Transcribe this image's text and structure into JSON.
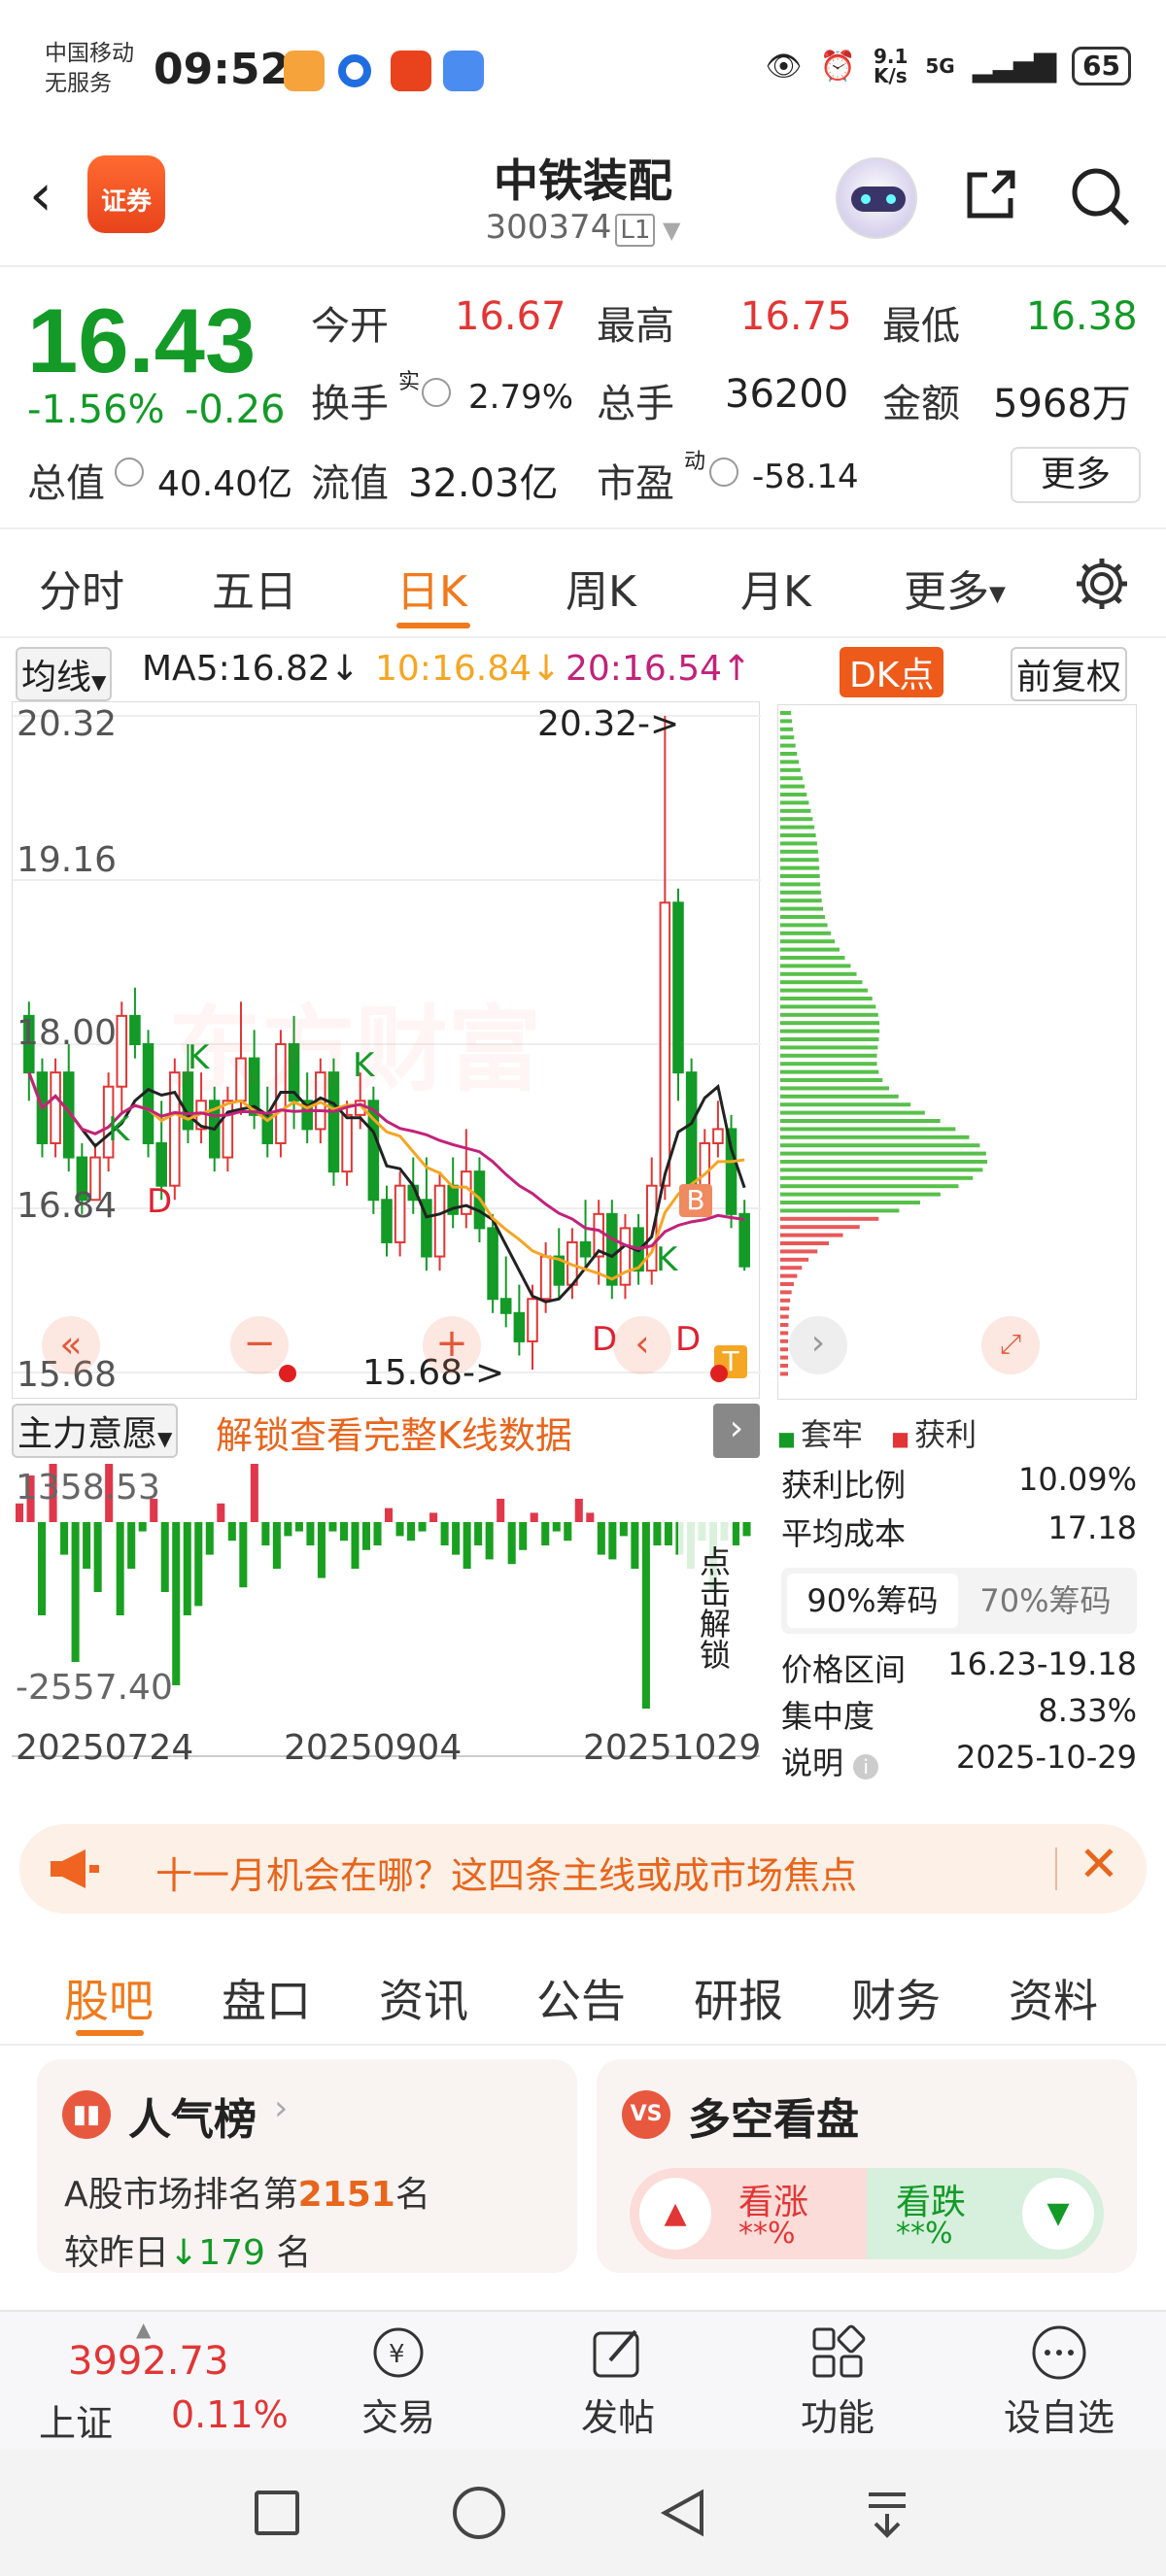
{
  "status": {
    "carrier_line1": "中国移动",
    "carrier_line2": "无服务",
    "time": "09:52",
    "net_speed": "9.1\nK/s",
    "network": "5G",
    "battery": "65"
  },
  "header": {
    "back_icon": "back-chevron-icon",
    "app_logo_text": "证券",
    "stock_name": "中铁装配",
    "stock_code": "300374",
    "level": "L1"
  },
  "quote": {
    "price": "16.43",
    "change_pct": "-1.56%",
    "change_abs": "-0.26",
    "open_label": "今开",
    "open": "16.67",
    "high_label": "最高",
    "high": "16.75",
    "low_label": "最低",
    "low": "16.38",
    "turnover_label": "换手",
    "turnover_sup": "实",
    "turnover": "2.79%",
    "volume_label": "总手",
    "volume": "36200",
    "amount_label": "金额",
    "amount": "5968万",
    "mktcap_label": "总值",
    "mktcap": "40.40亿",
    "float_label": "流值",
    "float_cap": "32.03亿",
    "pe_label": "市盈",
    "pe_sup": "动",
    "pe": "-58.14",
    "more": "更多"
  },
  "chart_tabs": [
    "分时",
    "五日",
    "日K",
    "周K",
    "月K",
    "更多"
  ],
  "active_tab": "日K",
  "ma_row": {
    "selector": "均线",
    "ma5": "MA5:16.82↓",
    "ma10": "10:16.84↓",
    "ma20": "20:16.54↑",
    "dk": "DK点",
    "adjust": "前复权"
  },
  "kchart": {
    "y_ticks": [
      "20.32",
      "19.16",
      "18.00",
      "16.84",
      "15.68"
    ],
    "max_marker": "20.32->",
    "min_marker": "15.68->",
    "watermark": "东方财富",
    "signal_k": "K",
    "signal_d": "D",
    "signal_b": "B",
    "signal_t": "T"
  },
  "chart_data": {
    "type": "candlestick",
    "ylim": [
      15.68,
      20.32
    ],
    "ohlc": [
      [
        18.2,
        18.3,
        17.6,
        17.8
      ],
      [
        17.8,
        17.9,
        17.2,
        17.3
      ],
      [
        17.3,
        17.9,
        17.2,
        17.8
      ],
      [
        17.8,
        18.0,
        17.1,
        17.2
      ],
      [
        17.2,
        17.3,
        16.8,
        16.9
      ],
      [
        16.9,
        17.3,
        16.9,
        17.2
      ],
      [
        17.2,
        17.8,
        17.1,
        17.7
      ],
      [
        17.7,
        18.3,
        17.5,
        18.2
      ],
      [
        18.2,
        18.4,
        17.9,
        18.0
      ],
      [
        18.0,
        18.1,
        17.2,
        17.3
      ],
      [
        17.3,
        17.6,
        16.9,
        17.0
      ],
      [
        17.0,
        17.9,
        16.9,
        17.8
      ],
      [
        17.8,
        18.0,
        17.3,
        17.4
      ],
      [
        17.4,
        17.8,
        17.3,
        17.6
      ],
      [
        17.6,
        17.7,
        17.1,
        17.2
      ],
      [
        17.2,
        17.7,
        17.1,
        17.6
      ],
      [
        17.6,
        18.3,
        17.5,
        17.9
      ],
      [
        17.9,
        18.1,
        17.4,
        17.5
      ],
      [
        17.5,
        17.7,
        17.2,
        17.3
      ],
      [
        17.3,
        18.1,
        17.2,
        18.0
      ],
      [
        18.0,
        18.2,
        17.4,
        17.6
      ],
      [
        17.6,
        17.8,
        17.3,
        17.4
      ],
      [
        17.4,
        17.9,
        17.3,
        17.8
      ],
      [
        17.8,
        17.9,
        17.0,
        17.1
      ],
      [
        17.1,
        17.6,
        17.0,
        17.5
      ],
      [
        17.5,
        17.8,
        17.4,
        17.6
      ],
      [
        17.6,
        17.7,
        16.8,
        16.9
      ],
      [
        16.9,
        17.0,
        16.5,
        16.6
      ],
      [
        16.6,
        17.1,
        16.5,
        17.0
      ],
      [
        17.0,
        17.2,
        16.8,
        16.9
      ],
      [
        16.9,
        17.2,
        16.4,
        16.5
      ],
      [
        16.5,
        17.1,
        16.4,
        17.0
      ],
      [
        17.0,
        17.2,
        16.7,
        16.8
      ],
      [
        16.8,
        17.4,
        16.7,
        17.1
      ],
      [
        17.1,
        17.2,
        16.6,
        16.7
      ],
      [
        16.7,
        16.8,
        16.1,
        16.2
      ],
      [
        16.2,
        16.5,
        16.0,
        16.1
      ],
      [
        16.1,
        16.3,
        15.8,
        15.9
      ],
      [
        15.9,
        16.3,
        15.7,
        16.2
      ],
      [
        16.2,
        16.6,
        16.1,
        16.5
      ],
      [
        16.5,
        16.7,
        16.2,
        16.3
      ],
      [
        16.3,
        16.7,
        16.2,
        16.6
      ],
      [
        16.6,
        16.9,
        16.4,
        16.5
      ],
      [
        16.5,
        16.9,
        16.3,
        16.8
      ],
      [
        16.8,
        16.9,
        16.2,
        16.3
      ],
      [
        16.3,
        16.8,
        16.2,
        16.7
      ],
      [
        16.7,
        16.8,
        16.3,
        16.4
      ],
      [
        16.4,
        17.2,
        16.3,
        17.0
      ],
      [
        17.0,
        20.32,
        16.9,
        19.0
      ],
      [
        19.0,
        19.1,
        17.6,
        17.8
      ],
      [
        17.8,
        17.9,
        16.8,
        17.0
      ],
      [
        17.0,
        17.4,
        16.9,
        17.3
      ],
      [
        17.3,
        17.6,
        17.2,
        17.4
      ],
      [
        17.4,
        17.5,
        16.7,
        16.8
      ],
      [
        16.8,
        16.9,
        16.4,
        16.43
      ]
    ]
  },
  "chips": {
    "legend_trapped": "套牢",
    "legend_profit": "获利",
    "rows": [
      {
        "label": "获利比例",
        "value": "10.09%"
      },
      {
        "label": "平均成本",
        "value": "17.18"
      }
    ],
    "tab_90": "90%筹码",
    "tab_70": "70%筹码",
    "rows2": [
      {
        "label": "价格区间",
        "value": "16.23-19.18"
      },
      {
        "label": "集中度",
        "value": "8.33%"
      },
      {
        "label": "说明",
        "value": "2025-10-29"
      }
    ]
  },
  "indicator": {
    "selector": "主力意愿",
    "unlock_text": "解锁查看完整K线数据",
    "top_value": "1358.53",
    "bottom_value": "-2557.40",
    "unlock_side": "点击解锁",
    "dates": [
      "20250724",
      "20250904",
      "20251029"
    ]
  },
  "banner": {
    "text": "十一月机会在哪？这四条主线或成市场焦点"
  },
  "bottom_tabs": [
    "股吧",
    "盘口",
    "资讯",
    "公告",
    "研报",
    "财务",
    "资料"
  ],
  "active_bottom_tab": "股吧",
  "popularity": {
    "title": "人气榜",
    "rank_prefix": "A股市场排名第",
    "rank": "2151",
    "rank_suffix": "名",
    "change_prefix": "较昨日",
    "change": "179",
    "change_suffix": "名"
  },
  "duokong": {
    "title": "多空看盘",
    "up_label": "看涨",
    "up_value": "**%",
    "down_label": "看跌",
    "down_value": "**%"
  },
  "bottom_nav": {
    "index_value": "3992.73",
    "index_name": "上证",
    "index_change": "0.11%",
    "items": [
      "交易",
      "发帖",
      "功能",
      "设自选"
    ]
  },
  "colors": {
    "up": "#e23535",
    "down": "#139a27",
    "accent": "#f07a1c"
  }
}
